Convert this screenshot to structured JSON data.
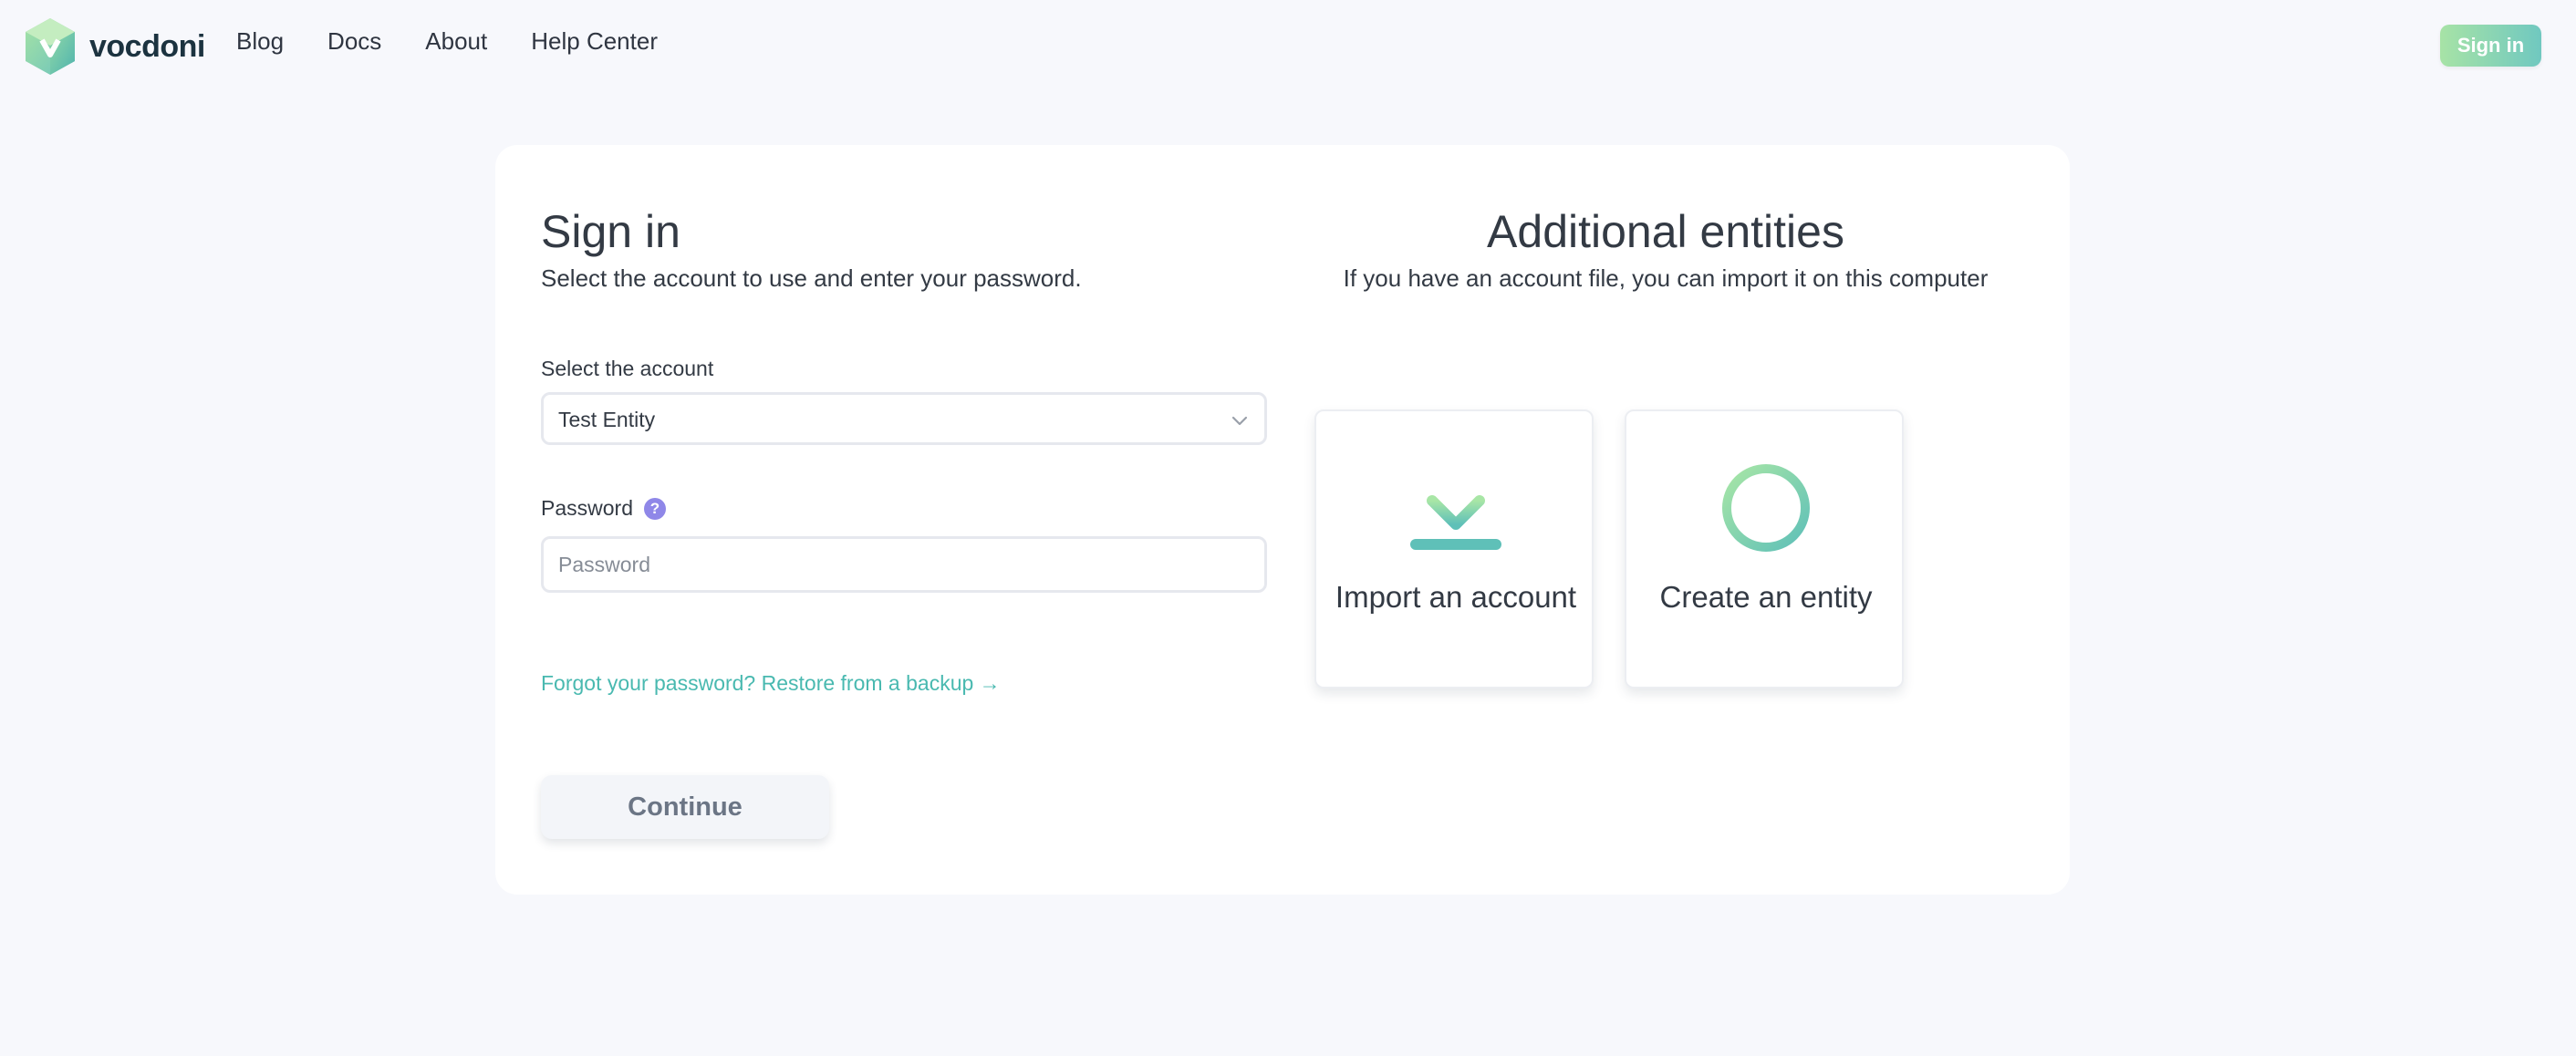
{
  "header": {
    "brand": "vocdoni",
    "nav": [
      {
        "label": "Blog"
      },
      {
        "label": "Docs"
      },
      {
        "label": "About"
      },
      {
        "label": "Help Center"
      }
    ],
    "signin_label": "Sign in"
  },
  "signin": {
    "title": "Sign in",
    "subtitle": "Select the account to use and enter your password.",
    "account_label": "Select the account",
    "account_value": "Test Entity",
    "password_label": "Password",
    "help_symbol": "?",
    "password_placeholder": "Password",
    "forgot_link": "Forgot your password? Restore from a backup →",
    "continue_label": "Continue"
  },
  "entities": {
    "title": "Additional entities",
    "subtitle": "If you have an account file, you can import it on this computer",
    "import_label": "Import an account",
    "create_label": "Create an entity"
  },
  "colors": {
    "background": "#f7f8fc",
    "accent_green": "#a7e3a6",
    "accent_teal": "#70c8c0",
    "link": "#49b9b0",
    "help": "#8f87e8"
  },
  "icons": {
    "logo": "vocdoni-hexagon-logo",
    "select_arrow": "chevron-down-icon",
    "help": "question-circle-icon",
    "import": "download-arrow-icon",
    "create": "plus-circle-icon"
  }
}
